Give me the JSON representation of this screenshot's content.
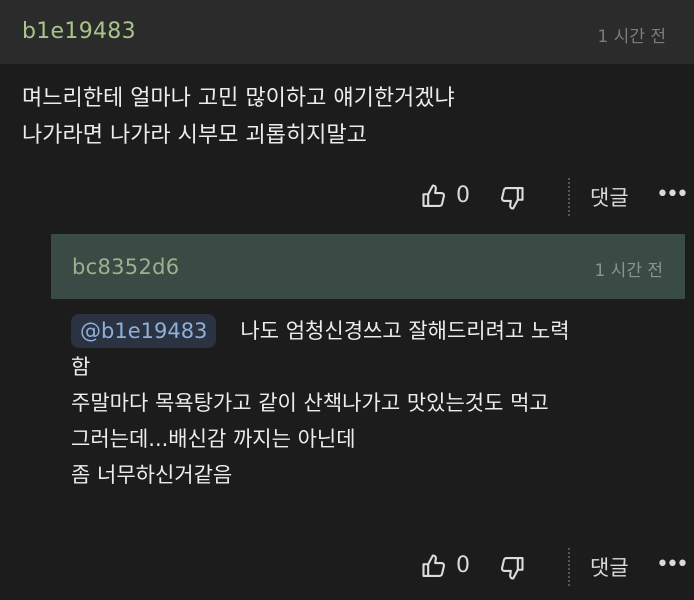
{
  "comment": {
    "username": "b1e19483",
    "time": "1 시간 전",
    "lines": [
      "며느리한테 얼마나 고민 많이하고 얘기한거겠냐",
      "나가라면 나가라 시부모 괴롭히지말고"
    ],
    "like_count": "0",
    "reply_label": "댓글",
    "more_label": "•••"
  },
  "reply": {
    "username": "bc8352d6",
    "time": "1 시간 전",
    "mention": "@b1e19483",
    "first_line": "나도 엄청신경쓰고 잘해드리려고 노력",
    "lines": [
      "함",
      "주말마다 목욕탕가고 같이 산책나가고 맛있는것도 먹고",
      "그러는데...배신감 까지는 아닌데",
      "좀 너무하신거같음"
    ],
    "like_count": "0",
    "reply_label": "댓글",
    "more_label": "•••"
  },
  "icons": {
    "like": "thumbs-up-icon",
    "dislike": "thumbs-down-icon",
    "more": "more-dots-icon"
  },
  "colors": {
    "background": "#1c1c1c",
    "comment_header": "#2b2b2b",
    "reply_header": "#3a4a45",
    "username": "#a9c48a",
    "mention_text": "#8fb0d8"
  }
}
